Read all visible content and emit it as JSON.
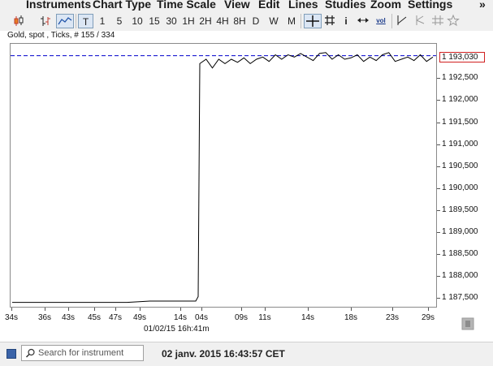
{
  "menu": {
    "items": [
      "Instruments",
      "Chart Type",
      "Time Scale",
      "View",
      "Edit",
      "Lines",
      "Studies",
      "Zoom",
      "Settings"
    ],
    "overflow": "»"
  },
  "toolbar": {
    "timeframes": [
      "T",
      "1",
      "5",
      "10",
      "15",
      "30",
      "1H",
      "2H",
      "4H",
      "8H",
      "D",
      "W",
      "M"
    ],
    "selected_timeframe": "T",
    "info_label": "i",
    "vol_label": "vol",
    "icons": [
      "candlestick-icon",
      "bar-chart-icon",
      "line-chart-icon",
      "crosshair-icon",
      "grid-icon",
      "info-icon",
      "fit-width-icon",
      "volume-icon",
      "trend-line-icon",
      "fork-icon",
      "hash-tool-icon",
      "star-icon"
    ]
  },
  "chart": {
    "title": "Gold, spot , Ticks, # 155 / 334",
    "current_price": "1 193,030",
    "date_label": "01/02/15 16h:41m",
    "line_color": "#000000",
    "price_line_color": "#0000cc",
    "price_box_color": "#d02020"
  },
  "chart_data": {
    "type": "line",
    "title": "Gold, spot , Ticks, # 155 / 334",
    "xlabel": "",
    "ylabel": "",
    "x_ticks": [
      "34s",
      "36s",
      "43s",
      "45s",
      "47s",
      "49s",
      "14s",
      "04s",
      "09s",
      "11s",
      "14s",
      "18s",
      "23s",
      "29s"
    ],
    "y_ticks": [
      "1 192,500",
      "1 192,000",
      "1 191,500",
      "1 191,000",
      "1 190,500",
      "1 190,000",
      "1 189,500",
      "1 189,000",
      "1 188,500",
      "1 188,000",
      "1 187,500"
    ],
    "y_values": [
      1192.5,
      1192.0,
      1191.5,
      1191.0,
      1190.5,
      1190.0,
      1189.5,
      1189.0,
      1188.5,
      1188.0,
      1187.5
    ],
    "ylim": [
      1187.32,
      1193.3
    ],
    "current_price": 1193.03,
    "series": [
      {
        "values": [
          1187.42,
          1187.42,
          1187.42,
          1187.42,
          1187.42,
          1187.42,
          1187.45,
          1187.45,
          1187.45,
          1187.55,
          1192.85,
          1192.95,
          1192.75,
          1192.95,
          1192.85,
          1192.95,
          1192.88,
          1192.98,
          1192.85,
          1192.95,
          1193.0,
          1192.9,
          1193.05,
          1192.95,
          1193.05,
          1193.0,
          1193.08,
          1193.0,
          1192.92,
          1193.08,
          1193.1,
          1192.95,
          1193.05,
          1192.95,
          1192.98,
          1193.05,
          1192.9,
          1193.0,
          1192.92,
          1193.05,
          1193.1,
          1192.9,
          1192.95,
          1193.0,
          1192.92,
          1193.05,
          1192.9,
          1193.0
        ]
      }
    ],
    "grid": false,
    "legend": "none"
  },
  "status": {
    "search_placeholder": "Search for instrument",
    "datetime": "02 janv. 2015 16:43:57 CET"
  }
}
